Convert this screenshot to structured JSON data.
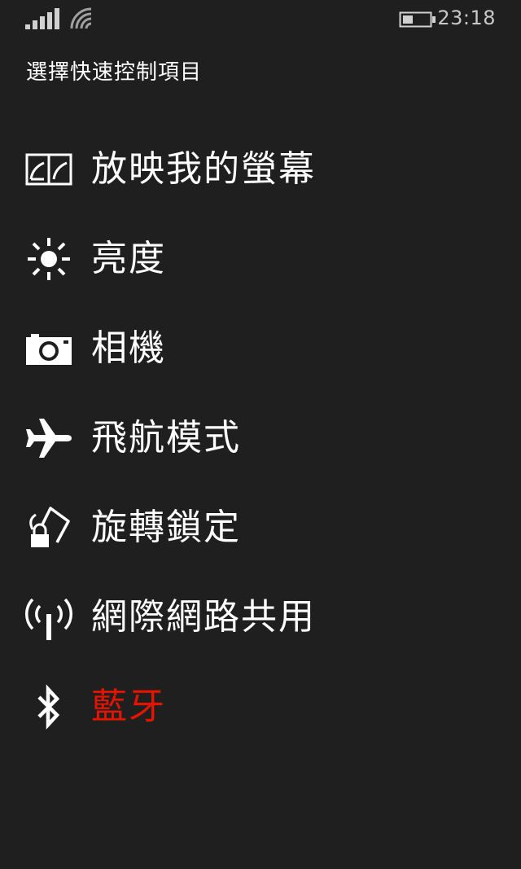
{
  "status_bar": {
    "time": "23:18",
    "signal_icon": "signal-strength-icon",
    "wifi_icon": "wifi-icon",
    "battery_icon": "battery-icon"
  },
  "page": {
    "title": "選擇快速控制項目"
  },
  "items": [
    {
      "label": "放映我的螢幕",
      "icon": "project-screen-icon"
    },
    {
      "label": "亮度",
      "icon": "brightness-icon"
    },
    {
      "label": "相機",
      "icon": "camera-icon"
    },
    {
      "label": "飛航模式",
      "icon": "airplane-icon"
    },
    {
      "label": "旋轉鎖定",
      "icon": "rotation-lock-icon"
    },
    {
      "label": "網際網路共用",
      "icon": "internet-sharing-icon"
    },
    {
      "label": "藍牙",
      "icon": "bluetooth-icon",
      "color": "#e51400"
    }
  ],
  "colors": {
    "background": "#1f1f1f",
    "text": "#ffffff",
    "highlight": "#e51400"
  }
}
